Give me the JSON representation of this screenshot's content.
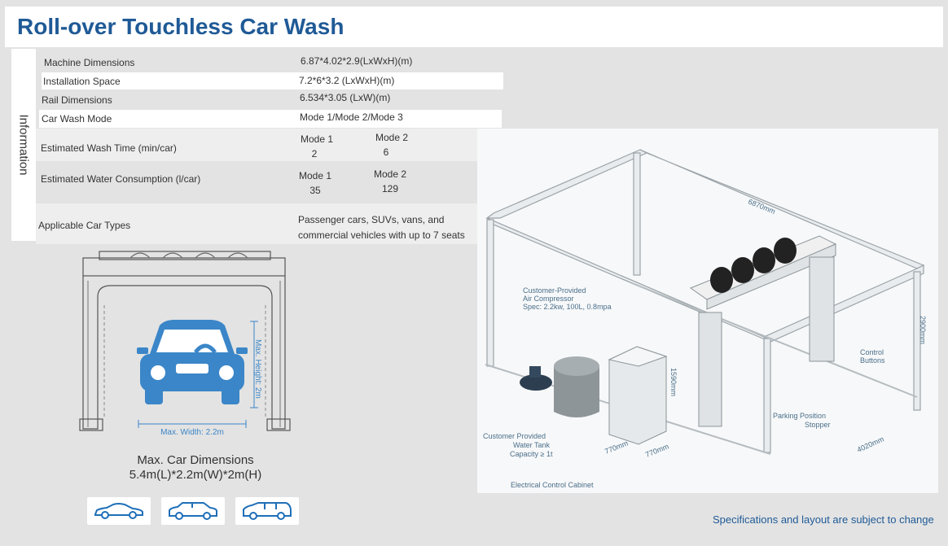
{
  "title": "Roll-over Touchless Car Wash",
  "info_tab": "Information",
  "specs": {
    "machine_dimensions": {
      "label": "Machine Dimensions",
      "value": "6.87*4.02*2.9(LxWxH)(m)"
    },
    "installation_space": {
      "label": "Installation Space",
      "value": "7.2*6*3.2 (LxWxH)(m)"
    },
    "rail_dimensions": {
      "label": "Rail Dimensions",
      "value": "6.534*3.05 (LxW)(m)"
    },
    "car_wash_mode": {
      "label": "Car Wash Mode",
      "value": "Mode 1/Mode 2/Mode 3"
    },
    "wash_time": {
      "label": "Estimated Wash Time (min/car)",
      "mode1_label": "Mode 1",
      "mode1_value": "2",
      "mode2_label": "Mode 2",
      "mode2_value": "6"
    },
    "water": {
      "label": "Estimated Water Consumption (l/car)",
      "mode1_label": "Mode 1",
      "mode1_value": "35",
      "mode2_label": "Mode 2",
      "mode2_value": "129"
    },
    "car_types": {
      "label": "Applicable Car Types",
      "line1": "Passenger cars, SUVs, vans, and",
      "line2": "commercial vehicles with up to 7 seats"
    }
  },
  "car_diagram": {
    "height_label": "Max. Height: 2m",
    "width_label": "Max. Width: 2.2m",
    "caption_line1": "Max. Car Dimensions",
    "caption_line2": "5.4m(L)*2.2m(W)*2m(H)"
  },
  "car_type_icons": [
    "sedan-icon",
    "suv-icon",
    "van-icon"
  ],
  "photo_labels": {
    "length": "6870mm",
    "height": "2900mm",
    "width": "4020mm",
    "cabinet_height": "1590mm",
    "cabinet_w1": "770mm",
    "cabinet_w2": "770mm",
    "air_compressor_1": "Customer-Provided",
    "air_compressor_2": "Air Compressor",
    "air_compressor_3": "Spec: 2.2kw, 100L, 0.8mpa",
    "control_buttons_1": "Control",
    "control_buttons_2": "Buttons",
    "parking_1": "Parking Position",
    "parking_2": "Stopper",
    "water_tank_1": "Customer Provided",
    "water_tank_2": "Water Tank",
    "water_tank_3": "Capacity ≥ 1t",
    "cabinet": "Electrical Control Cabinet"
  },
  "footer_note": "Specifications and layout are subject to change",
  "colors": {
    "brand_blue": "#1f5a96",
    "car_blue": "#3b86c8"
  }
}
